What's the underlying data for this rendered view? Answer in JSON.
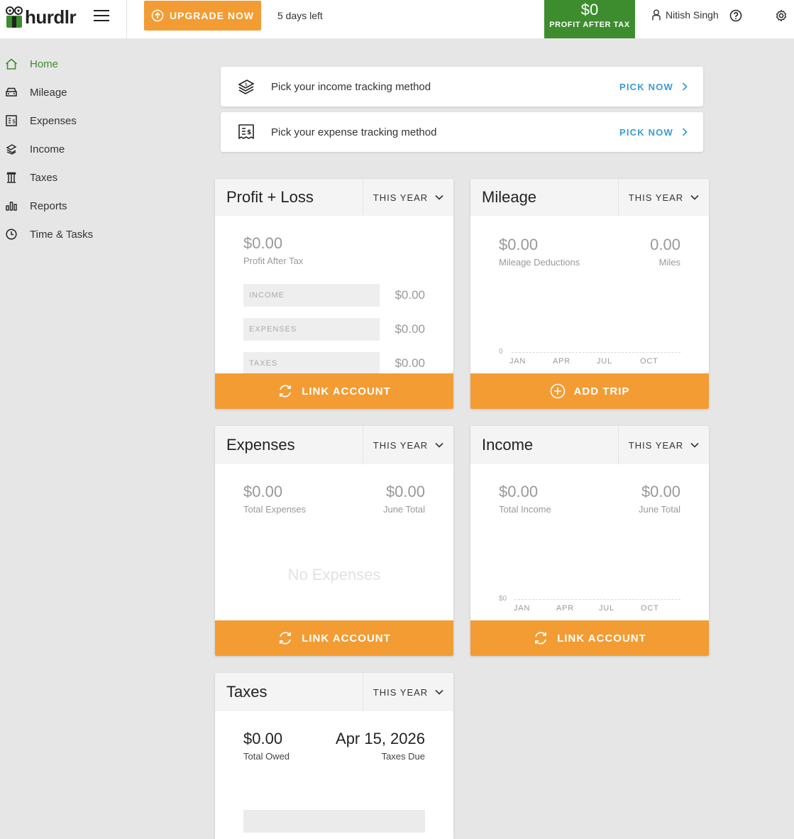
{
  "header": {
    "logo_text": "hurdlr",
    "upgrade_label": "UPGRADE NOW",
    "trial_text": "5 days left",
    "profit_value": "$0",
    "profit_label": "PROFIT AFTER TAX",
    "user_name": "Nitish Singh"
  },
  "sidebar": {
    "items": [
      {
        "label": "Home",
        "icon": "home-icon",
        "active": true
      },
      {
        "label": "Mileage",
        "icon": "car-icon"
      },
      {
        "label": "Expenses",
        "icon": "receipt-icon"
      },
      {
        "label": "Income",
        "icon": "money-stack-icon"
      },
      {
        "label": "Taxes",
        "icon": "government-building-icon"
      },
      {
        "label": "Reports",
        "icon": "bar-chart-icon"
      },
      {
        "label": "Time & Tasks",
        "icon": "clock-icon"
      }
    ]
  },
  "banners": [
    {
      "text": "Pick your income tracking method",
      "link": "PICK NOW"
    },
    {
      "text": "Pick your expense tracking method",
      "link": "PICK NOW"
    }
  ],
  "cards": {
    "profit_loss": {
      "title": "Profit + Loss",
      "period": "THIS YEAR",
      "value": "$0.00",
      "value_label": "Profit After Tax",
      "rows": [
        {
          "label": "INCOME",
          "amount": "$0.00"
        },
        {
          "label": "EXPENSES",
          "amount": "$0.00"
        },
        {
          "label": "TAXES",
          "amount": "$0.00"
        }
      ],
      "footer": "LINK ACCOUNT"
    },
    "mileage": {
      "title": "Mileage",
      "period": "THIS YEAR",
      "left_value": "$0.00",
      "left_label": "Mileage Deductions",
      "right_value": "0.00",
      "right_label": "Miles",
      "axis_zero": "0",
      "months": [
        "JAN",
        "APR",
        "JUL",
        "OCT"
      ],
      "footer": "ADD TRIP"
    },
    "expenses": {
      "title": "Expenses",
      "period": "THIS YEAR",
      "left_value": "$0.00",
      "left_label": "Total Expenses",
      "right_value": "$0.00",
      "right_label": "June Total",
      "empty_message": "No Expenses",
      "footer": "LINK ACCOUNT"
    },
    "income": {
      "title": "Income",
      "period": "THIS YEAR",
      "left_value": "$0.00",
      "left_label": "Total Income",
      "right_value": "$0.00",
      "right_label": "June Total",
      "axis_zero": "$0",
      "months": [
        "JAN",
        "APR",
        "JUL",
        "OCT"
      ],
      "footer": "LINK ACCOUNT"
    },
    "taxes": {
      "title": "Taxes",
      "period": "THIS YEAR",
      "left_value": "$0.00",
      "left_label": "Total Owed",
      "right_value": "Apr 15, 2026",
      "right_label": "Taxes Due"
    }
  },
  "colors": {
    "accent_orange": "#f39c33",
    "brand_green": "#3d8d2e",
    "link_blue": "#3a9bd5",
    "background": "#e6e6e6"
  }
}
